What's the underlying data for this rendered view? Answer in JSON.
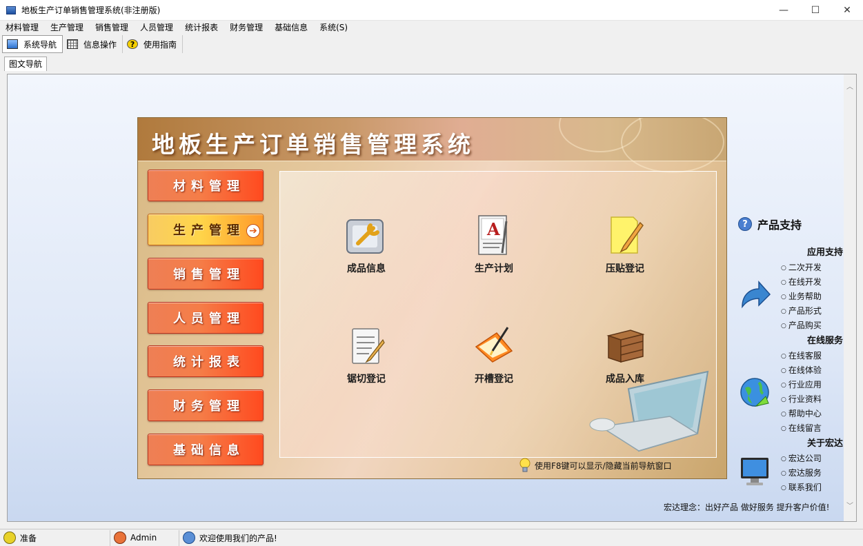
{
  "window": {
    "title": "地板生产订单销售管理系统(非注册版)",
    "minimize": "—",
    "maximize": "☐",
    "close": "✕"
  },
  "menu": [
    "材料管理",
    "生产管理",
    "销售管理",
    "人员管理",
    "统计报表",
    "财务管理",
    "基础信息",
    "系统(S)"
  ],
  "toolbar": {
    "nav_label": "系统导航",
    "info_label": "信息操作",
    "guide_label": "使用指南"
  },
  "tab": {
    "label": "图文导航"
  },
  "panel": {
    "title": "地板生产订单销售管理系统",
    "side_buttons": [
      "材料管理",
      "生产管理",
      "销售管理",
      "人员管理",
      "统计报表",
      "财务管理",
      "基础信息"
    ],
    "active_index": 1,
    "icons": [
      "成品信息",
      "生产计划",
      "压贴登记",
      "锯切登记",
      "开槽登记",
      "成品入库"
    ],
    "hint": "使用F8键可以显示/隐藏当前导航窗口"
  },
  "support": {
    "title": "产品支持",
    "sections": [
      {
        "title": "应用支持",
        "items": [
          "二次开发",
          "在线开发",
          "业务帮助",
          "产品形式",
          "产品购买"
        ]
      },
      {
        "title": "在线服务",
        "items": [
          "在线客服",
          "在线体验",
          "行业应用",
          "行业资料",
          "帮助中心",
          "在线留言"
        ]
      },
      {
        "title": "关于宏达",
        "items": [
          "宏达公司",
          "宏达服务",
          "联系我们"
        ]
      }
    ],
    "motto": "宏达理念：出好产品 做好服务 提升客户价值!"
  },
  "status": {
    "ready": "准备",
    "user": "Admin",
    "welcome": "欢迎使用我们的产品!"
  }
}
